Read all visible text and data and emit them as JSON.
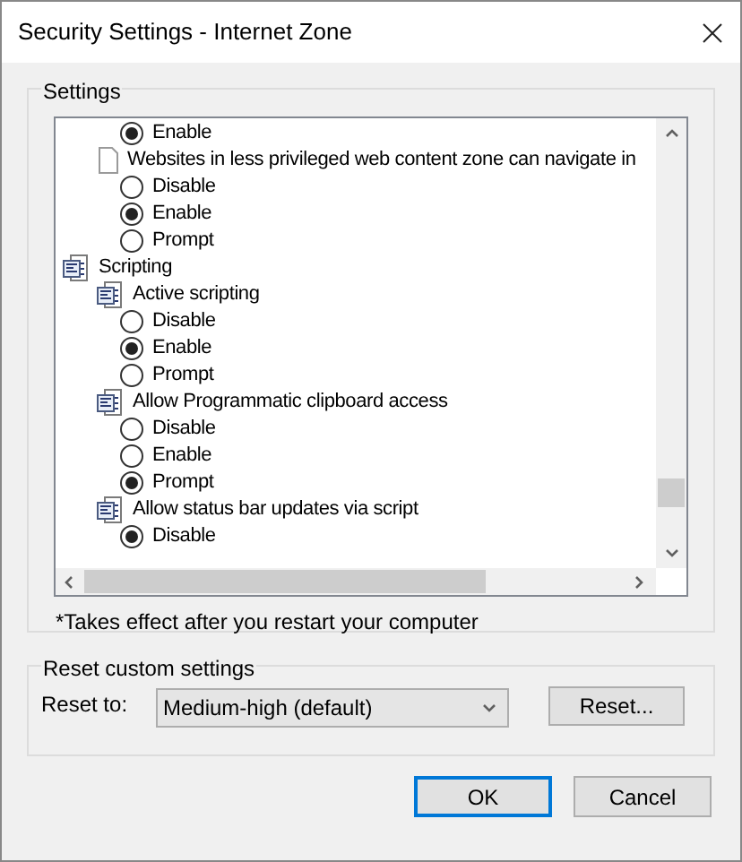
{
  "window": {
    "title": "Security Settings - Internet Zone"
  },
  "settings": {
    "legend": "Settings",
    "tree": [
      {
        "kind": "hidden",
        "children": [
          {
            "kind": "hidden",
            "children": [
              {
                "kind": "option",
                "label": "Enable",
                "selected": true
              }
            ]
          },
          {
            "kind": "page",
            "label": "Websites in less privileged web content zone can navigate in",
            "children": [
              {
                "kind": "option",
                "label": "Disable",
                "selected": false
              },
              {
                "kind": "option",
                "label": "Enable",
                "selected": true
              },
              {
                "kind": "option",
                "label": "Prompt",
                "selected": false
              }
            ]
          }
        ]
      },
      {
        "kind": "script",
        "label": "Scripting",
        "children": [
          {
            "kind": "script",
            "label": "Active scripting",
            "children": [
              {
                "kind": "option",
                "label": "Disable",
                "selected": false
              },
              {
                "kind": "option",
                "label": "Enable",
                "selected": true
              },
              {
                "kind": "option",
                "label": "Prompt",
                "selected": false
              }
            ]
          },
          {
            "kind": "script",
            "label": "Allow Programmatic clipboard access",
            "children": [
              {
                "kind": "option",
                "label": "Disable",
                "selected": false
              },
              {
                "kind": "option",
                "label": "Enable",
                "selected": false
              },
              {
                "kind": "option",
                "label": "Prompt",
                "selected": true
              }
            ]
          },
          {
            "kind": "script",
            "label": "Allow status bar updates via script",
            "children": [
              {
                "kind": "option",
                "label": "Disable",
                "selected": true
              }
            ]
          }
        ]
      }
    ],
    "note": "*Takes effect after you restart your computer"
  },
  "reset": {
    "legend": "Reset custom settings",
    "label": "Reset to:",
    "combo": "Medium-high (default)",
    "button": "Reset..."
  },
  "buttons": [
    {
      "label": "OK",
      "default": true
    },
    {
      "label": "Cancel",
      "default": false
    }
  ]
}
